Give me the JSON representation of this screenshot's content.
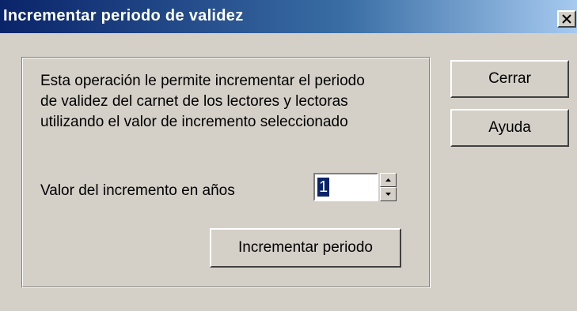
{
  "window": {
    "title": "Incrementar periodo de validez",
    "close_icon": "close-icon"
  },
  "description": {
    "line1": "Esta operación le permite incrementar el periodo",
    "line2": "de validez del carnet de los lectores y lectoras",
    "line3": "utilizando el valor de incremento seleccionado"
  },
  "increment": {
    "label": "Valor del incremento en años",
    "value": "1",
    "spin_up_icon": "arrow-up-icon",
    "spin_down_icon": "arrow-down-icon"
  },
  "buttons": {
    "incrementar": "Incrementar periodo",
    "cerrar": "Cerrar",
    "ayuda": "Ayuda"
  },
  "colors": {
    "title_gradient_start": "#0a246a",
    "title_gradient_end": "#a6caf0",
    "face": "#d4d0c8",
    "selection": "#0a246a"
  }
}
